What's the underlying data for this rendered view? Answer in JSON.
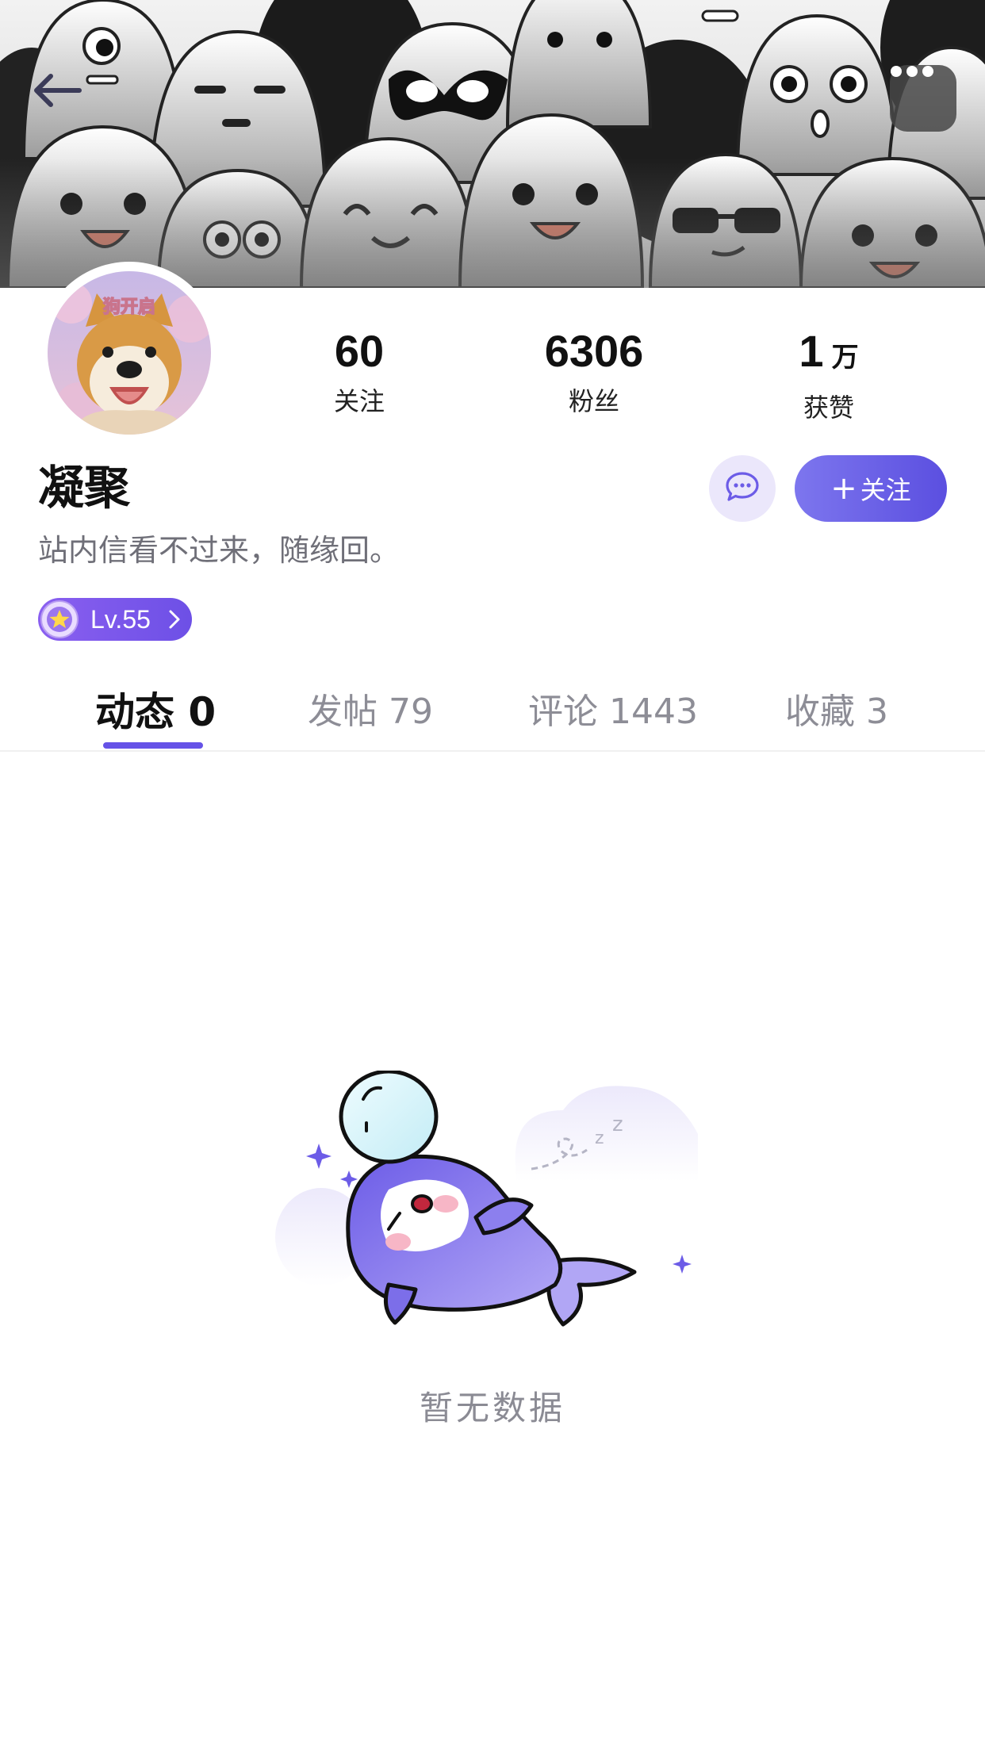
{
  "header": {
    "back_icon": "arrow-left-icon",
    "more_icon": "more-dots-icon"
  },
  "profile": {
    "avatar_caption": "狗开启",
    "name": "凝聚",
    "bio": "站内信看不过来，随缘回。",
    "level": "Lv.55",
    "stats": {
      "following": {
        "value": "60",
        "label": "关注"
      },
      "fans": {
        "value": "6306",
        "label": "粉丝"
      },
      "likes": {
        "value": "1",
        "unit": "万",
        "label": "获赞"
      }
    }
  },
  "actions": {
    "message_icon": "chat-bubble-icon",
    "follow_plus": "+",
    "follow_label": "关注"
  },
  "tabs": [
    {
      "label": "动态 0",
      "active": true
    },
    {
      "label": "发帖 79",
      "active": false
    },
    {
      "label": "评论 1443",
      "active": false
    },
    {
      "label": "收藏 3",
      "active": false
    }
  ],
  "empty_state": {
    "text": "暂无数据"
  },
  "colors": {
    "accent": "#6552e7",
    "follow_gradient_start": "#7d76ee",
    "follow_gradient_end": "#5b4fe0"
  }
}
